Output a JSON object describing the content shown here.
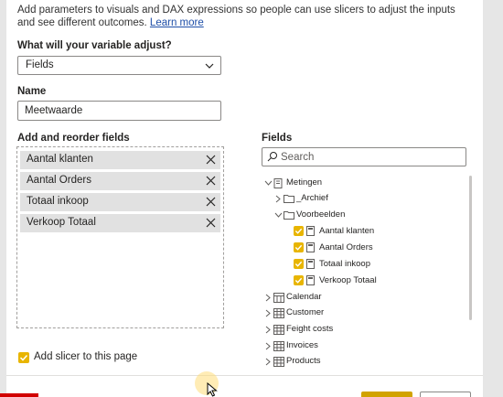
{
  "description": {
    "text": "Add parameters to visuals and DAX expressions so people can use slicers to adjust the inputs and see different outcomes.",
    "link": "Learn more"
  },
  "adjust": {
    "label": "What will your variable adjust?",
    "value": "Fields"
  },
  "name": {
    "label": "Name",
    "value": "Meetwaarde"
  },
  "fields_list": {
    "label": "Add and reorder fields",
    "items": [
      "Aantal klanten",
      "Aantal Orders",
      "Totaal inkoop",
      "Verkoop Totaal"
    ]
  },
  "add_slicer": {
    "label": "Add slicer to this page",
    "checked": true
  },
  "fields_pane": {
    "label": "Fields",
    "search_placeholder": "Search",
    "tree": {
      "metingen": "Metingen",
      "archief": "_Archief",
      "voorbeelden": "Voorbeelden",
      "measures": [
        "Aantal klanten",
        "Aantal Orders",
        "Totaal inkoop",
        "Verkoop Totaal"
      ],
      "calendar": "Calendar",
      "customer": "Customer",
      "feight_costs": "Feight costs",
      "invoices": "Invoices",
      "products": "Products"
    }
  },
  "colors": {
    "accent": "#e8b500",
    "link": "#1f4fa8",
    "chip": "#e1e1e1"
  }
}
